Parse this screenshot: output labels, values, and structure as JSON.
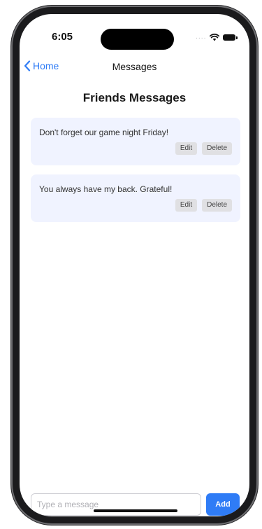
{
  "status_bar": {
    "time": "6:05",
    "signal": "....",
    "wifi_icon": "wifi-icon",
    "battery_icon": "battery-icon"
  },
  "nav": {
    "back_label": "Home",
    "back_icon": "chevron-left-icon",
    "title": "Messages"
  },
  "page": {
    "title": "Friends Messages"
  },
  "messages": [
    {
      "text": "Don't forget our game night Friday!",
      "edit_label": "Edit",
      "delete_label": "Delete"
    },
    {
      "text": "You always have my back. Grateful!",
      "edit_label": "Edit",
      "delete_label": "Delete"
    }
  ],
  "composer": {
    "placeholder": "Type a message",
    "value": "",
    "add_label": "Add"
  },
  "colors": {
    "accent": "#2f7cf6",
    "card_background": "#f0f3ff",
    "action_button": "#e0e0e3"
  }
}
